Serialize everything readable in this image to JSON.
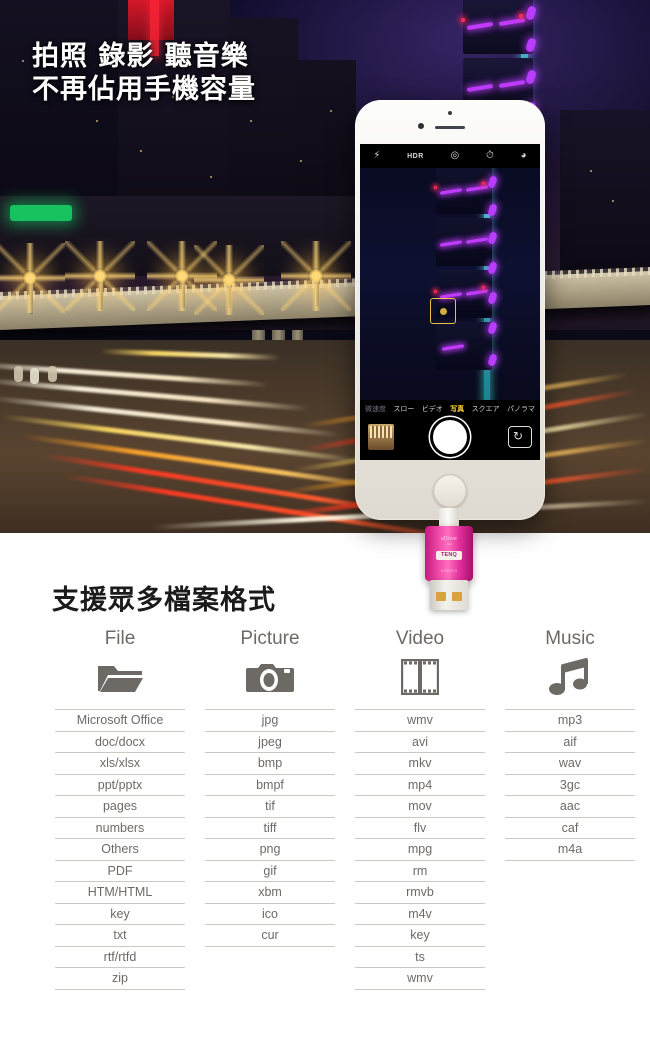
{
  "hero": {
    "headline_line1": "拍照 錄影 聽音樂",
    "headline_line2": "不再佔用手機容量"
  },
  "phone": {
    "camera_toolbar": [
      {
        "name": "flash-off-icon",
        "glyph": "⚡"
      },
      {
        "name": "hdr-icon",
        "glyph": "HDR"
      },
      {
        "name": "live-photo-off-icon",
        "glyph": "◎"
      },
      {
        "name": "timer-icon",
        "glyph": "⏱"
      },
      {
        "name": "filters-icon",
        "glyph": "◕"
      }
    ],
    "modes": [
      {
        "label": "微速度",
        "selected": false,
        "cut": true
      },
      {
        "label": "スロー",
        "selected": false,
        "cut": false
      },
      {
        "label": "ビデオ",
        "selected": false,
        "cut": false
      },
      {
        "label": "写真",
        "selected": true,
        "cut": false
      },
      {
        "label": "スクエア",
        "selected": false,
        "cut": false
      },
      {
        "label": "パノラマ",
        "selected": false,
        "cut": false
      }
    ],
    "shutter_label": "shutter",
    "flip_label": "flip-camera"
  },
  "usb_drive": {
    "brand_top": "uDrive",
    "brand_sub": "mini",
    "badge": "TENQ",
    "spec": "USB3.0"
  },
  "formats_section": {
    "title": "支援眾多檔案格式",
    "columns": [
      {
        "header": "File",
        "icon": "folder-icon",
        "items": [
          "Microsoft Office",
          "doc/docx",
          "xls/xlsx",
          "ppt/pptx",
          "pages",
          "numbers",
          "Others",
          "PDF",
          "HTM/HTML",
          "key",
          "txt",
          "rtf/rtfd",
          "zip"
        ]
      },
      {
        "header": "Picture",
        "icon": "camera-icon",
        "items": [
          "jpg",
          "jpeg",
          "bmp",
          "bmpf",
          "tif",
          "tiff",
          "png",
          "gif",
          "xbm",
          "ico",
          "cur"
        ]
      },
      {
        "header": "Video",
        "icon": "film-icon",
        "items": [
          "wmv",
          "avi",
          "mkv",
          "mp4",
          "mov",
          "flv",
          "mpg",
          "rm",
          "rmvb",
          "m4v",
          "key",
          "ts",
          "wmv"
        ]
      },
      {
        "header": "Music",
        "icon": "music-note-icon",
        "items": [
          "mp3",
          "aif",
          "wav",
          "3gc",
          "aac",
          "caf",
          "m4a"
        ]
      }
    ]
  },
  "colors": {
    "text_gray": "#6d6a66",
    "rule_gray": "#ccc9c4",
    "title_black": "#1b1b1b",
    "usb_pink": "#e0309a",
    "mode_selected_yellow": "#ffcf2e"
  }
}
